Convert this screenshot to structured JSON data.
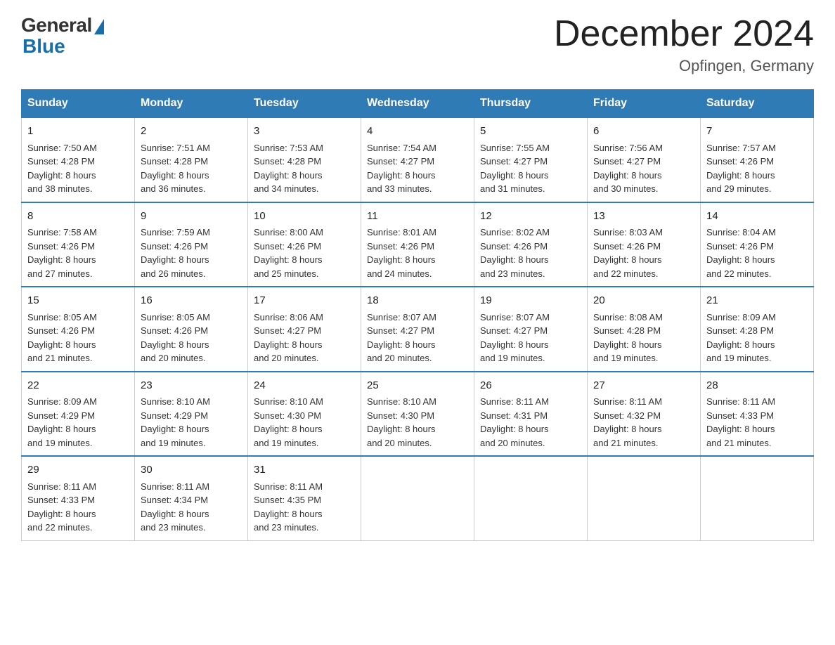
{
  "header": {
    "logo_general": "General",
    "logo_blue": "Blue",
    "title": "December 2024",
    "subtitle": "Opfingen, Germany"
  },
  "columns": [
    "Sunday",
    "Monday",
    "Tuesday",
    "Wednesday",
    "Thursday",
    "Friday",
    "Saturday"
  ],
  "weeks": [
    [
      {
        "day": "1",
        "sunrise": "Sunrise: 7:50 AM",
        "sunset": "Sunset: 4:28 PM",
        "daylight": "Daylight: 8 hours",
        "daylight2": "and 38 minutes."
      },
      {
        "day": "2",
        "sunrise": "Sunrise: 7:51 AM",
        "sunset": "Sunset: 4:28 PM",
        "daylight": "Daylight: 8 hours",
        "daylight2": "and 36 minutes."
      },
      {
        "day": "3",
        "sunrise": "Sunrise: 7:53 AM",
        "sunset": "Sunset: 4:28 PM",
        "daylight": "Daylight: 8 hours",
        "daylight2": "and 34 minutes."
      },
      {
        "day": "4",
        "sunrise": "Sunrise: 7:54 AM",
        "sunset": "Sunset: 4:27 PM",
        "daylight": "Daylight: 8 hours",
        "daylight2": "and 33 minutes."
      },
      {
        "day": "5",
        "sunrise": "Sunrise: 7:55 AM",
        "sunset": "Sunset: 4:27 PM",
        "daylight": "Daylight: 8 hours",
        "daylight2": "and 31 minutes."
      },
      {
        "day": "6",
        "sunrise": "Sunrise: 7:56 AM",
        "sunset": "Sunset: 4:27 PM",
        "daylight": "Daylight: 8 hours",
        "daylight2": "and 30 minutes."
      },
      {
        "day": "7",
        "sunrise": "Sunrise: 7:57 AM",
        "sunset": "Sunset: 4:26 PM",
        "daylight": "Daylight: 8 hours",
        "daylight2": "and 29 minutes."
      }
    ],
    [
      {
        "day": "8",
        "sunrise": "Sunrise: 7:58 AM",
        "sunset": "Sunset: 4:26 PM",
        "daylight": "Daylight: 8 hours",
        "daylight2": "and 27 minutes."
      },
      {
        "day": "9",
        "sunrise": "Sunrise: 7:59 AM",
        "sunset": "Sunset: 4:26 PM",
        "daylight": "Daylight: 8 hours",
        "daylight2": "and 26 minutes."
      },
      {
        "day": "10",
        "sunrise": "Sunrise: 8:00 AM",
        "sunset": "Sunset: 4:26 PM",
        "daylight": "Daylight: 8 hours",
        "daylight2": "and 25 minutes."
      },
      {
        "day": "11",
        "sunrise": "Sunrise: 8:01 AM",
        "sunset": "Sunset: 4:26 PM",
        "daylight": "Daylight: 8 hours",
        "daylight2": "and 24 minutes."
      },
      {
        "day": "12",
        "sunrise": "Sunrise: 8:02 AM",
        "sunset": "Sunset: 4:26 PM",
        "daylight": "Daylight: 8 hours",
        "daylight2": "and 23 minutes."
      },
      {
        "day": "13",
        "sunrise": "Sunrise: 8:03 AM",
        "sunset": "Sunset: 4:26 PM",
        "daylight": "Daylight: 8 hours",
        "daylight2": "and 22 minutes."
      },
      {
        "day": "14",
        "sunrise": "Sunrise: 8:04 AM",
        "sunset": "Sunset: 4:26 PM",
        "daylight": "Daylight: 8 hours",
        "daylight2": "and 22 minutes."
      }
    ],
    [
      {
        "day": "15",
        "sunrise": "Sunrise: 8:05 AM",
        "sunset": "Sunset: 4:26 PM",
        "daylight": "Daylight: 8 hours",
        "daylight2": "and 21 minutes."
      },
      {
        "day": "16",
        "sunrise": "Sunrise: 8:05 AM",
        "sunset": "Sunset: 4:26 PM",
        "daylight": "Daylight: 8 hours",
        "daylight2": "and 20 minutes."
      },
      {
        "day": "17",
        "sunrise": "Sunrise: 8:06 AM",
        "sunset": "Sunset: 4:27 PM",
        "daylight": "Daylight: 8 hours",
        "daylight2": "and 20 minutes."
      },
      {
        "day": "18",
        "sunrise": "Sunrise: 8:07 AM",
        "sunset": "Sunset: 4:27 PM",
        "daylight": "Daylight: 8 hours",
        "daylight2": "and 20 minutes."
      },
      {
        "day": "19",
        "sunrise": "Sunrise: 8:07 AM",
        "sunset": "Sunset: 4:27 PM",
        "daylight": "Daylight: 8 hours",
        "daylight2": "and 19 minutes."
      },
      {
        "day": "20",
        "sunrise": "Sunrise: 8:08 AM",
        "sunset": "Sunset: 4:28 PM",
        "daylight": "Daylight: 8 hours",
        "daylight2": "and 19 minutes."
      },
      {
        "day": "21",
        "sunrise": "Sunrise: 8:09 AM",
        "sunset": "Sunset: 4:28 PM",
        "daylight": "Daylight: 8 hours",
        "daylight2": "and 19 minutes."
      }
    ],
    [
      {
        "day": "22",
        "sunrise": "Sunrise: 8:09 AM",
        "sunset": "Sunset: 4:29 PM",
        "daylight": "Daylight: 8 hours",
        "daylight2": "and 19 minutes."
      },
      {
        "day": "23",
        "sunrise": "Sunrise: 8:10 AM",
        "sunset": "Sunset: 4:29 PM",
        "daylight": "Daylight: 8 hours",
        "daylight2": "and 19 minutes."
      },
      {
        "day": "24",
        "sunrise": "Sunrise: 8:10 AM",
        "sunset": "Sunset: 4:30 PM",
        "daylight": "Daylight: 8 hours",
        "daylight2": "and 19 minutes."
      },
      {
        "day": "25",
        "sunrise": "Sunrise: 8:10 AM",
        "sunset": "Sunset: 4:30 PM",
        "daylight": "Daylight: 8 hours",
        "daylight2": "and 20 minutes."
      },
      {
        "day": "26",
        "sunrise": "Sunrise: 8:11 AM",
        "sunset": "Sunset: 4:31 PM",
        "daylight": "Daylight: 8 hours",
        "daylight2": "and 20 minutes."
      },
      {
        "day": "27",
        "sunrise": "Sunrise: 8:11 AM",
        "sunset": "Sunset: 4:32 PM",
        "daylight": "Daylight: 8 hours",
        "daylight2": "and 21 minutes."
      },
      {
        "day": "28",
        "sunrise": "Sunrise: 8:11 AM",
        "sunset": "Sunset: 4:33 PM",
        "daylight": "Daylight: 8 hours",
        "daylight2": "and 21 minutes."
      }
    ],
    [
      {
        "day": "29",
        "sunrise": "Sunrise: 8:11 AM",
        "sunset": "Sunset: 4:33 PM",
        "daylight": "Daylight: 8 hours",
        "daylight2": "and 22 minutes."
      },
      {
        "day": "30",
        "sunrise": "Sunrise: 8:11 AM",
        "sunset": "Sunset: 4:34 PM",
        "daylight": "Daylight: 8 hours",
        "daylight2": "and 23 minutes."
      },
      {
        "day": "31",
        "sunrise": "Sunrise: 8:11 AM",
        "sunset": "Sunset: 4:35 PM",
        "daylight": "Daylight: 8 hours",
        "daylight2": "and 23 minutes."
      },
      {
        "day": "",
        "sunrise": "",
        "sunset": "",
        "daylight": "",
        "daylight2": ""
      },
      {
        "day": "",
        "sunrise": "",
        "sunset": "",
        "daylight": "",
        "daylight2": ""
      },
      {
        "day": "",
        "sunrise": "",
        "sunset": "",
        "daylight": "",
        "daylight2": ""
      },
      {
        "day": "",
        "sunrise": "",
        "sunset": "",
        "daylight": "",
        "daylight2": ""
      }
    ]
  ]
}
